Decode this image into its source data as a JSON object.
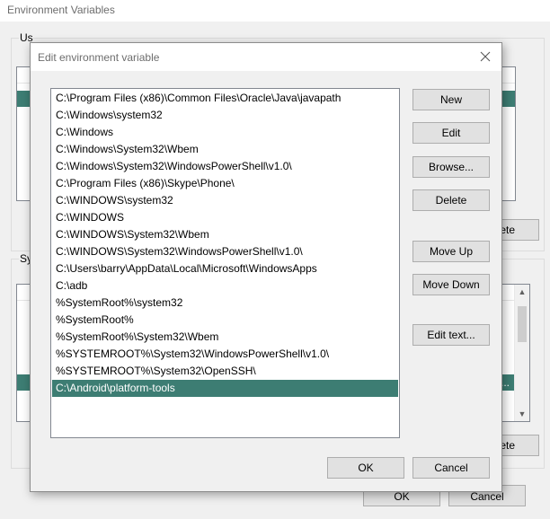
{
  "parent_window": {
    "title": "Environment Variables",
    "user_group_label": "User variables for barry",
    "system_group_label": "System variables",
    "user_stub_button_label": "Delete",
    "system_stub_button_label": "Delete",
    "system_row_tail": "...",
    "ok_label": "OK",
    "cancel_label": "Cancel"
  },
  "dialog": {
    "title": "Edit environment variable",
    "paths": [
      "C:\\Program Files (x86)\\Common Files\\Oracle\\Java\\javapath",
      "C:\\Windows\\system32",
      "C:\\Windows",
      "C:\\Windows\\System32\\Wbem",
      "C:\\Windows\\System32\\WindowsPowerShell\\v1.0\\",
      "C:\\Program Files (x86)\\Skype\\Phone\\",
      "C:\\WINDOWS\\system32",
      "C:\\WINDOWS",
      "C:\\WINDOWS\\System32\\Wbem",
      "C:\\WINDOWS\\System32\\WindowsPowerShell\\v1.0\\",
      "C:\\Users\\barry\\AppData\\Local\\Microsoft\\WindowsApps",
      "C:\\adb",
      "%SystemRoot%\\system32",
      "%SystemRoot%",
      "%SystemRoot%\\System32\\Wbem",
      "%SYSTEMROOT%\\System32\\WindowsPowerShell\\v1.0\\",
      "%SYSTEMROOT%\\System32\\OpenSSH\\",
      "C:\\Android\\platform-tools"
    ],
    "selected_index": 17,
    "buttons": {
      "new": "New",
      "edit": "Edit",
      "browse": "Browse...",
      "delete": "Delete",
      "move_up": "Move Up",
      "move_down": "Move Down",
      "edit_text": "Edit text...",
      "ok": "OK",
      "cancel": "Cancel"
    }
  },
  "colors": {
    "selection": "#3d7d73",
    "dialog_background": "#f0f0f0",
    "button_face": "#e1e1e1"
  }
}
